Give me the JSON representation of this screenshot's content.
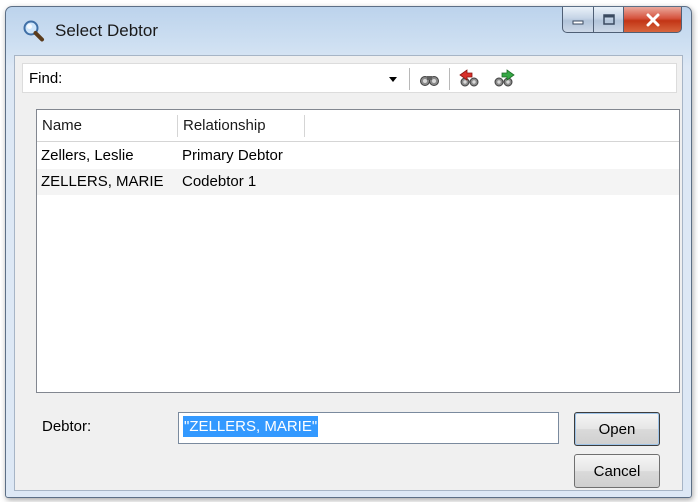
{
  "window": {
    "title": "Select Debtor"
  },
  "toolbar": {
    "find_label": "Find:",
    "find_value": ""
  },
  "list": {
    "columns": [
      "Name",
      "Relationship"
    ],
    "rows": [
      {
        "name": "Zellers, Leslie",
        "relationship": "Primary Debtor"
      },
      {
        "name": "ZELLERS, MARIE",
        "relationship": "Codebtor 1"
      }
    ]
  },
  "debtor": {
    "label": "Debtor:",
    "value": "\"ZELLERS, MARIE\""
  },
  "buttons": {
    "open": "Open",
    "cancel": "Cancel"
  },
  "colors": {
    "selection": "#3399ff",
    "close_button": "#c23516"
  }
}
